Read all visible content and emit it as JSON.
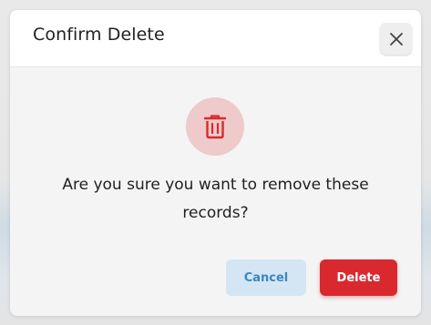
{
  "dialog": {
    "title": "Confirm Delete",
    "close_icon": "close-icon",
    "icon": "trash-icon",
    "message": "Are you sure you want to remove these records?",
    "cancel_label": "Cancel",
    "delete_label": "Delete"
  },
  "colors": {
    "danger": "#d9292f",
    "danger_light": "#efcaca",
    "cancel_bg": "#d4e6f3",
    "cancel_text": "#3a86c1"
  }
}
